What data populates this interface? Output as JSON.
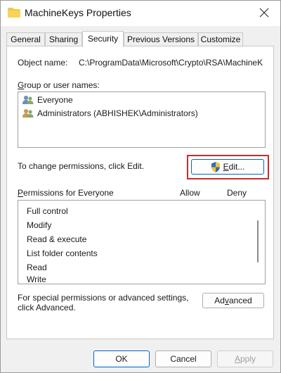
{
  "window": {
    "title": "MachineKeys Properties"
  },
  "tabs": [
    {
      "label": "General"
    },
    {
      "label": "Sharing"
    },
    {
      "label": "Security"
    },
    {
      "label": "Previous Versions"
    },
    {
      "label": "Customize"
    }
  ],
  "security": {
    "object_name_label": "Object name:",
    "object_name_value": "C:\\ProgramData\\Microsoft\\Crypto\\RSA\\MachineK",
    "group_label_first": "G",
    "group_label_rest": "roup or user names:",
    "users": [
      {
        "name": "Everyone",
        "icon": "users-group-icon"
      },
      {
        "name": "Administrators (ABHISHEK\\Administrators)",
        "icon": "users-group-icon"
      }
    ],
    "change_permissions_text": "To change permissions, click Edit.",
    "edit_button_first": "E",
    "edit_button_rest": "dit...",
    "edit_button_icon": "uac-shield-icon",
    "permissions_label_first": "P",
    "permissions_label_rest": "ermissions for Everyone",
    "allow_header": "Allow",
    "deny_header": "Deny",
    "permissions": [
      {
        "name": "Full control"
      },
      {
        "name": "Modify"
      },
      {
        "name": "Read & execute"
      },
      {
        "name": "List folder contents"
      },
      {
        "name": "Read"
      },
      {
        "name": "Write"
      }
    ],
    "special_text_line1": "For special permissions or advanced settings,",
    "special_text_line2": "click Advanced.",
    "advanced_button_pre": "Ad",
    "advanced_button_u": "v",
    "advanced_button_post": "anced"
  },
  "footer": {
    "ok_label": "OK",
    "cancel_label": "Cancel",
    "apply_label_first": "A",
    "apply_label_rest": "pply"
  },
  "colors": {
    "highlight": "#cc2a2a",
    "primary_border": "#0067c0",
    "folder": "#f3c744"
  }
}
